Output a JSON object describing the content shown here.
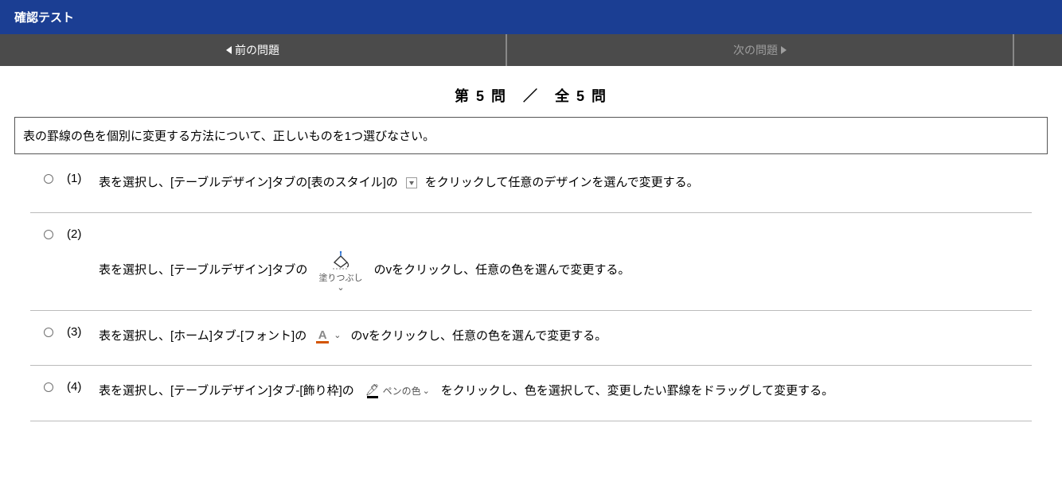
{
  "header": {
    "title": "確認テスト"
  },
  "nav": {
    "prev_label": "前の問題",
    "next_label": "次の問題"
  },
  "counter": {
    "text": "第 5 問　／　全 5 問"
  },
  "question": {
    "text": "表の罫線の色を個別に変更する方法について、正しいものを1つ選びなさい。"
  },
  "answers": [
    {
      "num": "(1)",
      "pre": "表を選択し、[テーブルデザイン]タブの[表のスタイル]の",
      "post": "をクリックして任意のデザインを選んで変更する。"
    },
    {
      "num": "(2)",
      "pre": "表を選択し、[テーブルデザイン]タブの",
      "tool_label": "塗りつぶし",
      "post": "のvをクリックし、任意の色を選んで変更する。"
    },
    {
      "num": "(3)",
      "pre": "表を選択し、[ホーム]タブ-[フォント]の",
      "post": "のvをクリックし、任意の色を選んで変更する。"
    },
    {
      "num": "(4)",
      "pre": "表を選択し、[テーブルデザイン]タブ-[飾り枠]の",
      "tool_label": "ペンの色",
      "post": "をクリックし、色を選択して、変更したい罫線をドラッグして変更する。"
    }
  ]
}
